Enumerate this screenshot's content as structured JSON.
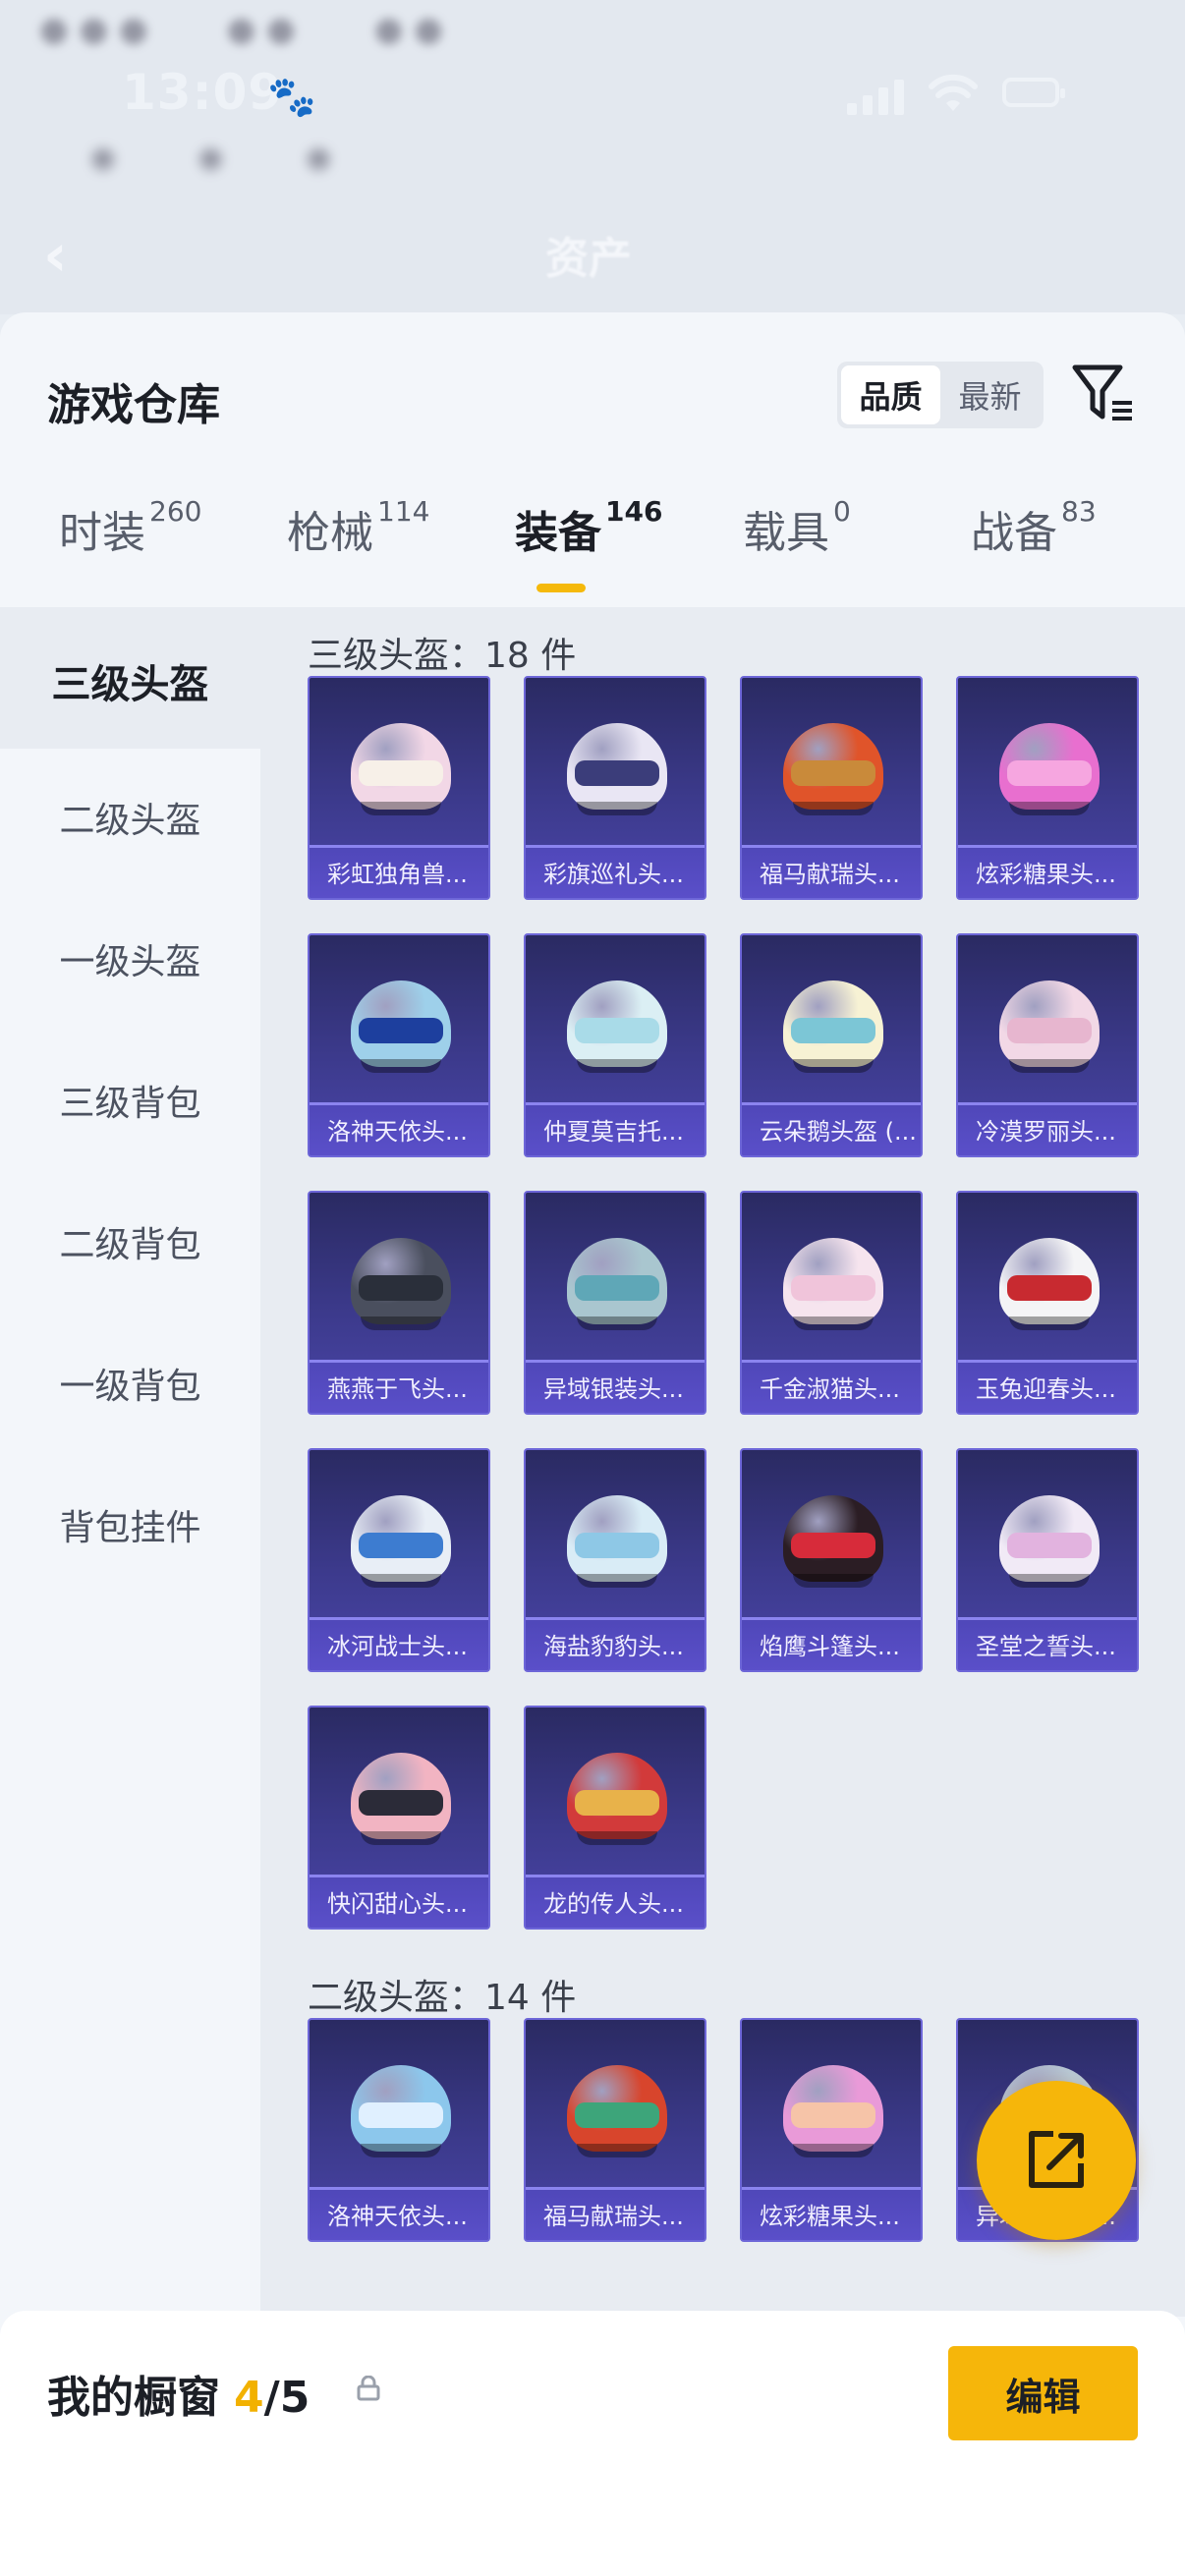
{
  "status": {
    "time": "13:09"
  },
  "nav": {
    "back_icon": "back-chevron-icon",
    "title": "资产"
  },
  "panel": {
    "title": "游戏仓库",
    "sort": {
      "options": [
        "品质",
        "最新"
      ],
      "selected": "品质"
    },
    "filter_icon": "filter-icon"
  },
  "tabs": [
    {
      "label": "时装",
      "count": "260"
    },
    {
      "label": "枪械",
      "count": "114"
    },
    {
      "label": "装备",
      "count": "146",
      "active": true
    },
    {
      "label": "载具",
      "count": "0"
    },
    {
      "label": "战备",
      "count": "83"
    }
  ],
  "sidebar": {
    "items": [
      "三级头盔",
      "二级头盔",
      "一级头盔",
      "三级背包",
      "二级背包",
      "一级背包",
      "背包挂件"
    ],
    "selected": "三级头盔"
  },
  "sections": [
    {
      "title": "三级头盔：18 件",
      "items": [
        {
          "name": "彩虹独角兽...",
          "color": "#f2d7e6",
          "visor": "#f7f0e8"
        },
        {
          "name": "彩旗巡礼头...",
          "color": "#e9e6f4",
          "visor": "#3b3d7a"
        },
        {
          "name": "福马献瑞头...",
          "color": "#e0542a",
          "visor": "#c98a3a"
        },
        {
          "name": "炫彩糖果头...",
          "color": "#e86fcf",
          "visor": "#f6a6e0"
        },
        {
          "name": "洛神天依头...",
          "color": "#9ed0ea",
          "visor": "#1d3f9e"
        },
        {
          "name": "仲夏莫吉托...",
          "color": "#dbeff4",
          "visor": "#a9dbe8"
        },
        {
          "name": "云朵鹅头盔 (...",
          "color": "#f7f2d4",
          "visor": "#7cc6d6"
        },
        {
          "name": "冷漠罗丽头...",
          "color": "#f2d8e6",
          "visor": "#e7b6cf"
        },
        {
          "name": "燕燕于飞头...",
          "color": "#4a4f5e",
          "visor": "#2a2f3a"
        },
        {
          "name": "异域银装头...",
          "color": "#a9c6cf",
          "visor": "#5fa7b7"
        },
        {
          "name": "千金淑猫头...",
          "color": "#f6e4ee",
          "visor": "#f0c4da"
        },
        {
          "name": "玉兔迎春头...",
          "color": "#f4f4f6",
          "visor": "#c82a30"
        },
        {
          "name": "冰河战士头...",
          "color": "#e8eef6",
          "visor": "#3d7cd0"
        },
        {
          "name": "海盐豹豹头...",
          "color": "#d9ecf6",
          "visor": "#8ec8e6"
        },
        {
          "name": "焰鹰斗篷头...",
          "color": "#2b1d24",
          "visor": "#d72b3a"
        },
        {
          "name": "圣堂之誓头...",
          "color": "#f1eaf6",
          "visor": "#e2b3df"
        },
        {
          "name": "快闪甜心头...",
          "color": "#f2b4c2",
          "visor": "#2b2b38"
        },
        {
          "name": "龙的传人头...",
          "color": "#d23a3a",
          "visor": "#e8b24a"
        }
      ]
    },
    {
      "title": "二级头盔：14 件",
      "items": [
        {
          "name": "洛神天依头...",
          "color": "#8cc7ec",
          "visor": "#e0f0ff"
        },
        {
          "name": "福马献瑞头...",
          "color": "#d8452c",
          "visor": "#3da57a"
        },
        {
          "name": "炫彩糖果头...",
          "color": "#e99ad8",
          "visor": "#f6c4a8"
        },
        {
          "name": "异域银装头...",
          "color": "#b8c8d4",
          "visor": "#6a8ca0"
        }
      ]
    }
  ],
  "fab": {
    "icon": "share-icon"
  },
  "bottom": {
    "title": "我的橱窗",
    "count": "4",
    "total": "/5",
    "lock_icon": "lock-icon",
    "edit_label": "编辑"
  }
}
